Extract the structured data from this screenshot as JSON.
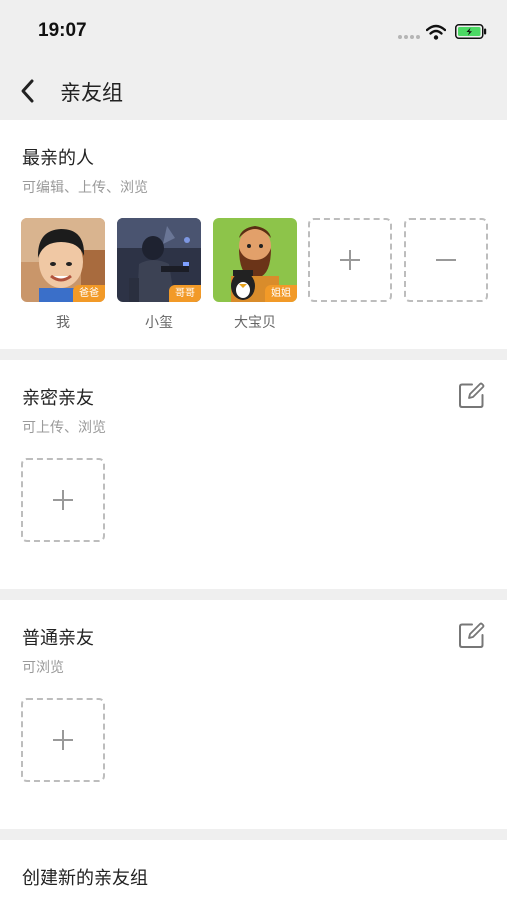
{
  "status_bar": {
    "time": "19:07"
  },
  "nav": {
    "title": "亲友组"
  },
  "closest": {
    "title": "最亲的人",
    "permission": "可编辑、上传、浏览",
    "members": [
      {
        "name": "我",
        "tag": "爸爸"
      },
      {
        "name": "小玺",
        "tag": "哥哥"
      },
      {
        "name": "大宝贝",
        "tag": "姐姐"
      }
    ]
  },
  "intimate": {
    "title": "亲密亲友",
    "permission": "可上传、浏览"
  },
  "normal": {
    "title": "普通亲友",
    "permission": "可浏览"
  },
  "create_group": {
    "label": "创建新的亲友组"
  },
  "colors": {
    "accent": "#f29a28",
    "background": "#efefef",
    "battery": "#4cd964"
  }
}
